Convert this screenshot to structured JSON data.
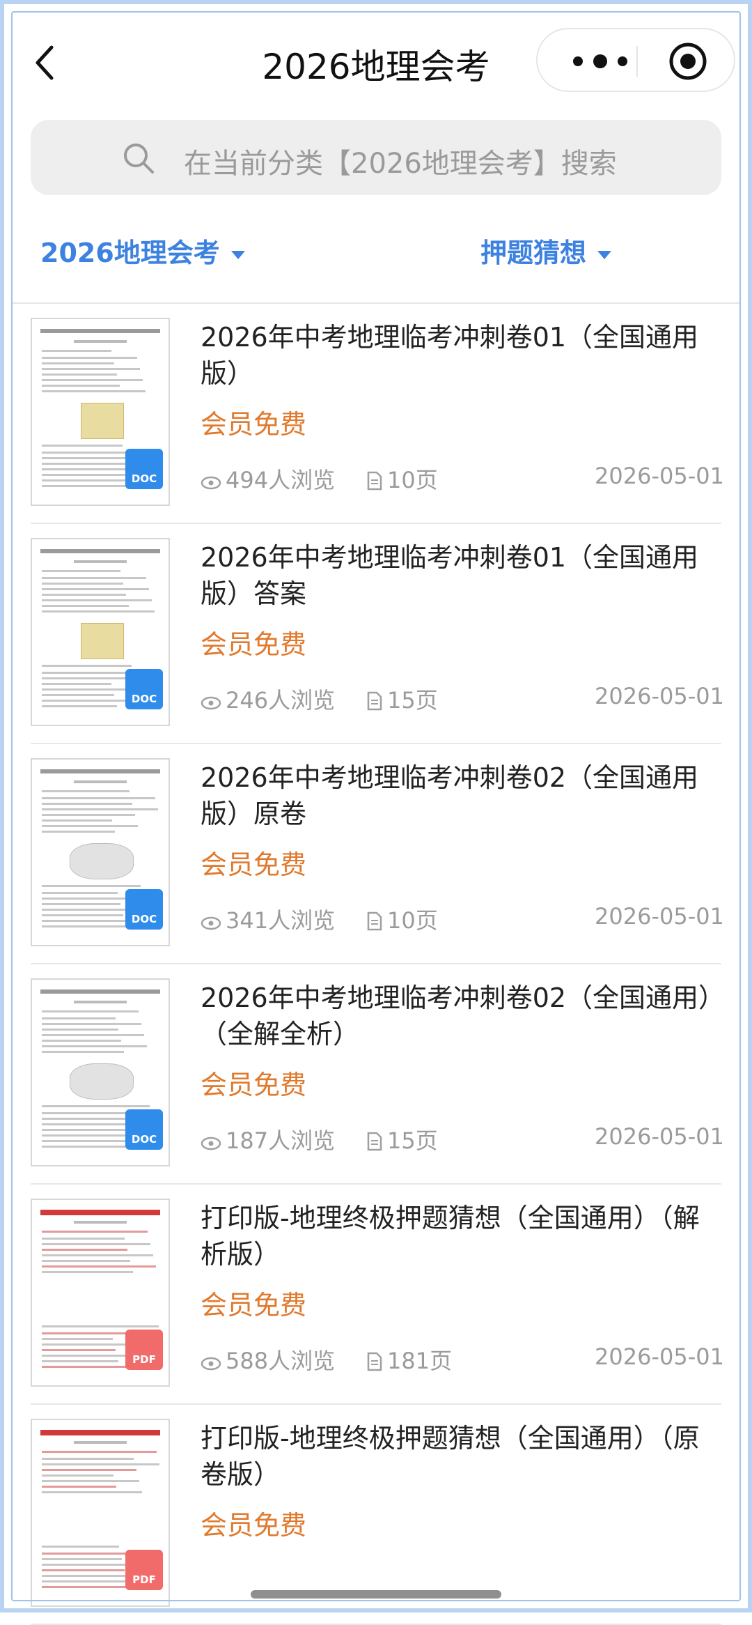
{
  "header": {
    "title": "2026地理会考",
    "back_icon": "chevron-left-icon",
    "more_icon": "more-dots-icon",
    "close_icon": "record-icon"
  },
  "search": {
    "placeholder": "在当前分类【2026地理会考】搜索",
    "icon": "search-icon"
  },
  "filters": [
    {
      "label": "2026地理会考"
    },
    {
      "label": "押题猜想"
    }
  ],
  "colors": {
    "accent": "#3d82e0",
    "price": "#e07a2e",
    "doc_badge": "#2f8ceb",
    "pdf_badge": "#f26b6b"
  },
  "items": [
    {
      "title": "2026年中考地理临考冲刺卷01（全国通用版）",
      "price": "会员免费",
      "views": "494人浏览",
      "pages": "10页",
      "date": "2026-05-01",
      "file_type": "DOC"
    },
    {
      "title": "2026年中考地理临考冲刺卷01（全国通用版）答案",
      "price": "会员免费",
      "views": "246人浏览",
      "pages": "15页",
      "date": "2026-05-01",
      "file_type": "DOC"
    },
    {
      "title": "2026年中考地理临考冲刺卷02（全国通用版）原卷",
      "price": "会员免费",
      "views": "341人浏览",
      "pages": "10页",
      "date": "2026-05-01",
      "file_type": "DOC"
    },
    {
      "title": "2026年中考地理临考冲刺卷02（全国通用）（全解全析）",
      "price": "会员免费",
      "views": "187人浏览",
      "pages": "15页",
      "date": "2026-05-01",
      "file_type": "DOC"
    },
    {
      "title": "打印版-地理终极押题猜想（全国通用）（解析版）",
      "price": "会员免费",
      "views": "588人浏览",
      "pages": "181页",
      "date": "2026-05-01",
      "file_type": "PDF"
    },
    {
      "title": "打印版-地理终极押题猜想（全国通用）（原卷版）",
      "price": "会员免费",
      "views": "",
      "pages": "",
      "date": "",
      "file_type": "PDF"
    }
  ]
}
